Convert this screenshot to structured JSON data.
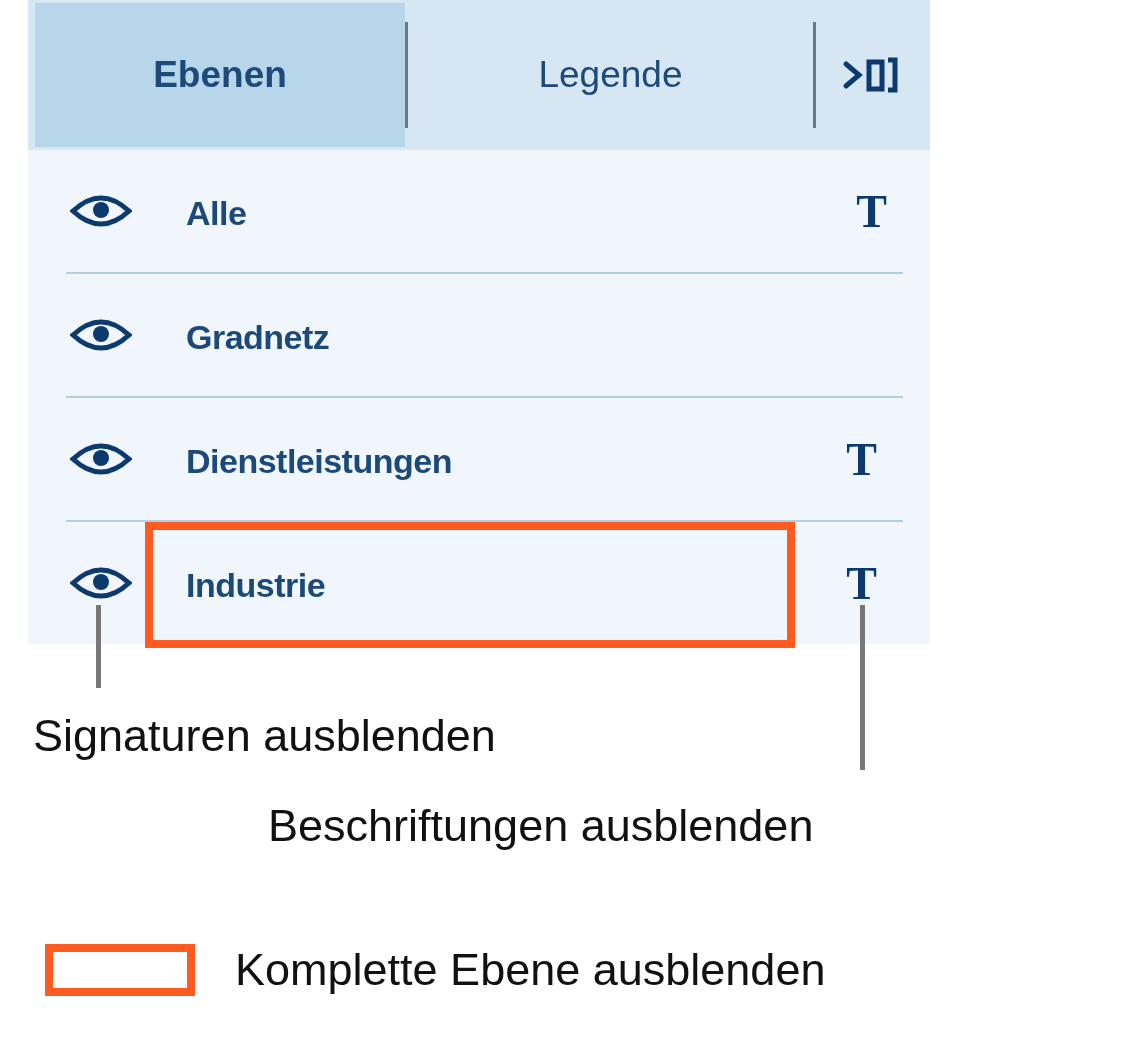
{
  "tabs": [
    {
      "label": "Ebenen",
      "selected": true
    },
    {
      "label": "Legende",
      "selected": false
    }
  ],
  "layers": [
    {
      "name": "Alle",
      "visible": true,
      "label_toggle": "T",
      "highlighted": false
    },
    {
      "name": "Gradnetz",
      "visible": true,
      "highlighted": false
    },
    {
      "name": "Dienstleistungen",
      "visible": true,
      "label_toggle": "T",
      "highlighted": false
    },
    {
      "name": "Industrie",
      "visible": true,
      "label_toggle": "T",
      "highlighted": true
    }
  ],
  "callouts": [
    {
      "text": "Signaturen ausblenden"
    },
    {
      "text": "Beschriftungen ausblenden"
    }
  ],
  "legend": {
    "text": "Komplette Ebene ausblenden"
  }
}
